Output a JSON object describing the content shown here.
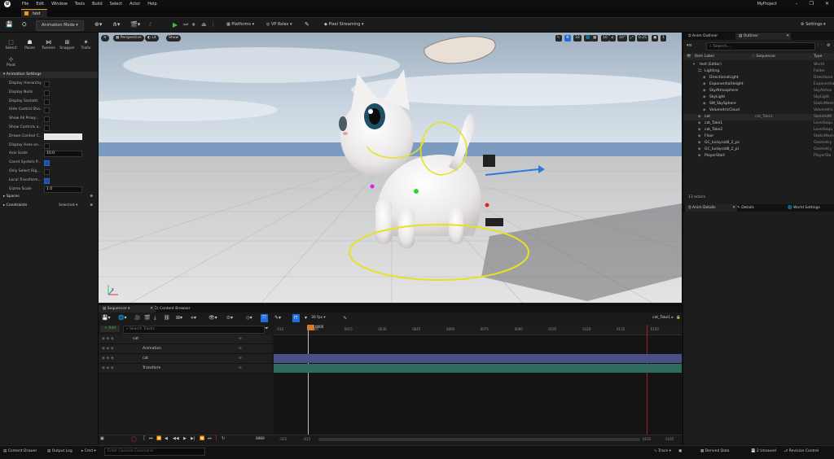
{
  "menu": {
    "logo": "U",
    "items": [
      "File",
      "Edit",
      "Window",
      "Tools",
      "Build",
      "Select",
      "Actor",
      "Help"
    ],
    "project_name": "MyProject",
    "window_controls": [
      "–",
      "❐",
      "✕"
    ]
  },
  "level_tab": {
    "label": "test"
  },
  "toolbar": {
    "mode": "Animation Mode",
    "platforms": "Platforms",
    "vp_roles": "VP Roles",
    "pixel_streaming": "Pixel Streaming",
    "settings": "Settings"
  },
  "left_panel": {
    "tools": [
      "Select",
      "Poses",
      "Tweens",
      "Snapper",
      "Traits",
      "Pivot"
    ],
    "animation_settings_header": "Animation Settings",
    "properties": [
      {
        "label": "Display Hierarchy",
        "kind": "check",
        "checked": false
      },
      {
        "label": "Display Nulls",
        "kind": "check",
        "checked": false
      },
      {
        "label": "Display Sockets",
        "kind": "check",
        "checked": false
      },
      {
        "label": "Hide Control Sha...",
        "kind": "check",
        "checked": false
      },
      {
        "label": "Show All Proxy...",
        "kind": "check",
        "checked": false
      },
      {
        "label": "Show Controls a...",
        "kind": "check",
        "checked": false
      },
      {
        "label": "Drawn Control C...",
        "kind": "color",
        "value": ""
      },
      {
        "label": "Display Axes on...",
        "kind": "check",
        "checked": false
      },
      {
        "label": "Axis Scale",
        "kind": "value",
        "value": "10.0"
      },
      {
        "label": "Coord System P...",
        "kind": "check",
        "checked": true
      },
      {
        "label": "Only Select Rig...",
        "kind": "check",
        "checked": false
      },
      {
        "label": "Local Transform...",
        "kind": "check",
        "checked": true
      },
      {
        "label": "Gizmo Scale",
        "kind": "value",
        "value": "1.0"
      }
    ],
    "spaces_header": "Spaces",
    "constraints_header": "Constraints",
    "constraints_value": "Selected"
  },
  "viewport": {
    "menu_icon": "≡",
    "perspective": "Perspective",
    "lit": "Lit",
    "show": "Show",
    "right_controls": [
      "↖",
      "✥",
      "10",
      "🌐",
      "▦",
      "10",
      "∠",
      "10°",
      "⤢",
      "0.25",
      "▣",
      "1"
    ],
    "axis_label": "z"
  },
  "outliner": {
    "tabs": [
      "Anim Outliner",
      "Outliner"
    ],
    "search_placeholder": "Search...",
    "col_item_label": "Item Label",
    "col_sequencer": "Sequencer",
    "col_type": "Type",
    "rows": [
      {
        "name": "test (Editor)",
        "indent": 1,
        "seq": "",
        "type": "World"
      },
      {
        "name": "Lighting",
        "indent": 2,
        "seq": "",
        "type": "Folder"
      },
      {
        "name": "DirectionalLight",
        "indent": 3,
        "seq": "",
        "type": "Directiona"
      },
      {
        "name": "ExponentialHeight",
        "indent": 3,
        "seq": "",
        "type": "Exponentia"
      },
      {
        "name": "SkyAtmosphere",
        "indent": 3,
        "seq": "",
        "type": "SkyAtmos"
      },
      {
        "name": "SkyLight",
        "indent": 3,
        "seq": "",
        "type": "SkyLight"
      },
      {
        "name": "SM_SkySphere",
        "indent": 3,
        "seq": "",
        "type": "StaticMesh"
      },
      {
        "name": "VolumetricCloud",
        "indent": 3,
        "seq": "",
        "type": "Volumetric"
      },
      {
        "name": "cat",
        "indent": 2,
        "seq": "cat_Take1",
        "type": "SkeletalM"
      },
      {
        "name": "cat_Take1",
        "indent": 2,
        "seq": "",
        "type": "LevelSequ"
      },
      {
        "name": "cat_Take2",
        "indent": 2,
        "seq": "",
        "type": "LevelSequ"
      },
      {
        "name": "Floor",
        "indent": 2,
        "seq": "",
        "type": "StaticMesh"
      },
      {
        "name": "GC_luckycat8_2_pc",
        "indent": 2,
        "seq": "",
        "type": "Geometry"
      },
      {
        "name": "GC_luckycat8_2_pl",
        "indent": 2,
        "seq": "",
        "type": "Geometry"
      },
      {
        "name": "PlayerStart",
        "indent": 2,
        "seq": "",
        "type": "PlayerSta"
      }
    ],
    "count": "13 actors"
  },
  "details": {
    "tabs": [
      "Anim Details",
      "Details",
      "World Settings"
    ]
  },
  "sequencer": {
    "tabs": [
      "Sequencer",
      "Content Browser"
    ],
    "add_label": "+ Add",
    "search_placeholder": "Search Tracks",
    "fps": "30 fps",
    "sequence_name": "cat_Take1",
    "playhead": "0000",
    "ruler": [
      "-015",
      "0000",
      "0015",
      "0030",
      "0045",
      "0060",
      "0075",
      "0090",
      "0105",
      "0120",
      "0135",
      "0150"
    ],
    "tracks": [
      {
        "label": "cat",
        "indent": 0
      },
      {
        "label": "Animation",
        "indent": 1
      },
      {
        "label": "cat",
        "indent": 1
      },
      {
        "label": "Transform",
        "indent": 1
      }
    ],
    "bottom": {
      "frame": "0000",
      "left1": "-015",
      "left2": "-015",
      "right1": "0165",
      "right2": "0165"
    }
  },
  "statusbar": {
    "content_drawer": "Content Drawer",
    "output_log": "Output Log",
    "cmd": "Cmd",
    "console_placeholder": "Enter Console Command",
    "trace": "Trace",
    "derived_data": "Derived Data",
    "unsaved": "2 Unsaved",
    "revision": "Revision Control"
  },
  "colors": {
    "accent": "#e09b17",
    "play": "#3fbf3f",
    "selected_blue": "#1f6fd6",
    "cat_track": "#4a4f86",
    "transform_track": "#2f6b5c",
    "gizmo_yellow": "#e7e121"
  }
}
